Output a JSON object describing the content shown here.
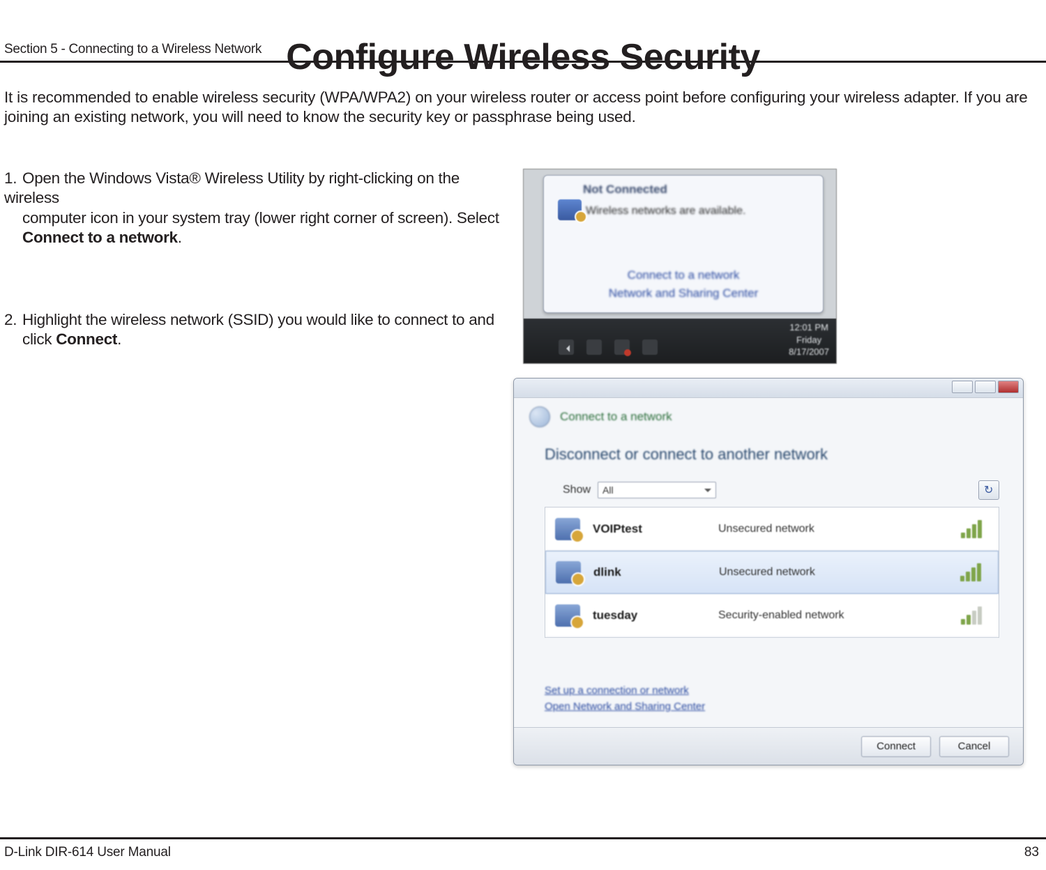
{
  "header": {
    "section": "Section 5 - Connecting to a Wireless Network"
  },
  "title": "Configure Wireless Security",
  "intro": "It is recommended to enable wireless security (WPA/WPA2) on your wireless router or access point before configuring your wireless adapter. If you are joining an existing network, you will need to know the security key or passphrase being used.",
  "steps": {
    "s1_num": "1.",
    "s1_line1": "Open the Windows Vista® Wireless Utility by right-clicking on the wireless",
    "s1_line2_a": "computer icon in your system tray (lower right corner of screen). Select ",
    "s1_line3_bold": "Connect to a network",
    "s1_line3_tail": ".",
    "s2_num": "2.",
    "s2_line1": "Highlight the wireless network (SSID) you would like to connect to and",
    "s2_line2_a": "click ",
    "s2_line2_bold": "Connect",
    "s2_line2_tail": "."
  },
  "shot1": {
    "balloon_title": "Not Connected",
    "balloon_sub": "Wireless networks are available.",
    "link1": "Connect to a network",
    "link2": "Network and Sharing Center",
    "clock_time": "12:01 PM",
    "clock_day": "Friday",
    "clock_date": "8/17/2007"
  },
  "shot2": {
    "header_text": "Connect to a network",
    "subtitle": "Disconnect or connect to another network",
    "show_label": "Show",
    "show_value": "All",
    "networks": [
      {
        "ssid": "VOIPtest",
        "security": "Unsecured network",
        "selected": false,
        "signal": "full"
      },
      {
        "ssid": "dlink",
        "security": "Unsecured network",
        "selected": true,
        "signal": "full"
      },
      {
        "ssid": "tuesday",
        "security": "Security-enabled network",
        "selected": false,
        "signal": "low"
      }
    ],
    "link_setup": "Set up a connection or network",
    "link_center": "Open Network and Sharing Center",
    "btn_connect": "Connect",
    "btn_cancel": "Cancel"
  },
  "footer": {
    "left": "D-Link DIR-614 User Manual",
    "right": "83"
  }
}
